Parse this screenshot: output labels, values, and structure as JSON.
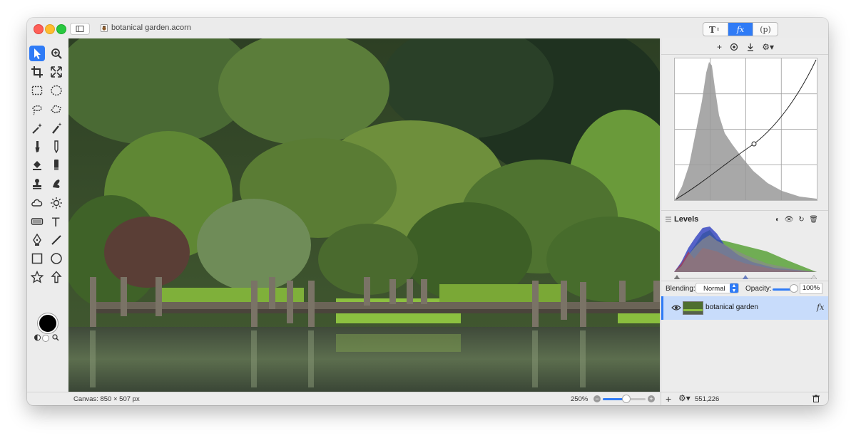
{
  "window": {
    "title": "botanical garden.acorn",
    "inspector_tabs": [
      {
        "label": "T",
        "name": "text-style"
      },
      {
        "label": "fx",
        "name": "filters"
      },
      {
        "label": "(p)",
        "name": "plugins"
      }
    ],
    "active_tab": "fx"
  },
  "toolbox": {
    "tools": [
      "select-arrow-icon",
      "zoom-icon",
      "crop-icon",
      "transform-icon",
      "rect-marquee-icon",
      "ellipse-marquee-icon",
      "lasso-icon",
      "polygon-lasso-icon",
      "magic-wand-icon",
      "magic-brush-icon",
      "brush-icon",
      "pencil-icon",
      "paint-bucket-icon",
      "eraser-icon",
      "clone-stamp-icon",
      "smudge-icon",
      "cloud-icon",
      "sun-icon",
      "gradient-icon",
      "text-icon",
      "pen-icon",
      "line-icon",
      "rectangle-shape-icon",
      "oval-shape-icon",
      "star-shape-icon",
      "arrow-shape-icon"
    ],
    "active_tool": "select-arrow-icon",
    "foreground_color": "#000000",
    "background_color": "#ffffff"
  },
  "status": {
    "canvas_size": "Canvas: 850 × 507 px",
    "zoom": "250%",
    "zoom_fraction": 0.55,
    "coordinates": "551,226"
  },
  "filters": {
    "toolbar_icons": [
      "add-icon",
      "filter-preset-icon",
      "download-icon",
      "gear-icon"
    ],
    "curves": {
      "point": [
        0.56,
        0.6
      ]
    },
    "levels": {
      "title": "Levels",
      "icons": [
        "contrast-icon",
        "visibility-eye-icon",
        "reset-icon",
        "trash-icon"
      ],
      "black_point": 0.0,
      "midpoint": 0.5,
      "white_point": 1.0
    }
  },
  "layers": {
    "blending_label": "Blending:",
    "blending_value": "Normal",
    "opacity_label": "Opacity:",
    "opacity_value": "100%",
    "opacity_fraction": 1.0,
    "items": [
      {
        "name": "botanical garden",
        "fx": "fx",
        "visible": true,
        "selected": true
      }
    ]
  },
  "colors": {
    "accent": "#2f7bf6",
    "selection": "#c8dcfb"
  }
}
